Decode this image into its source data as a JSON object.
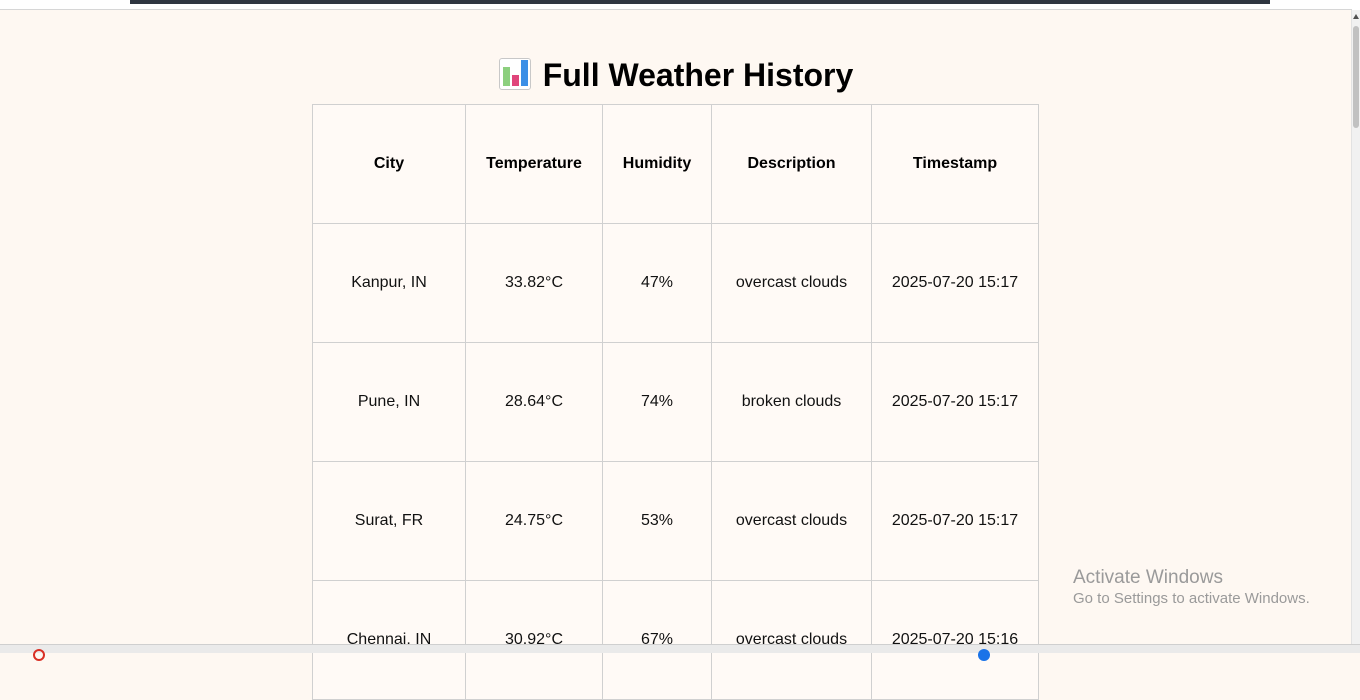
{
  "page": {
    "title": "Full Weather History",
    "title_icon": "bar-chart-icon"
  },
  "table": {
    "headers": {
      "city": "City",
      "temperature": "Temperature",
      "humidity": "Humidity",
      "description": "Description",
      "timestamp": "Timestamp"
    },
    "rows": [
      {
        "city": "Kanpur, IN",
        "temperature": "33.82°C",
        "humidity": "47%",
        "description": "overcast clouds",
        "timestamp": "2025-07-20 15:17"
      },
      {
        "city": "Pune, IN",
        "temperature": "28.64°C",
        "humidity": "74%",
        "description": "broken clouds",
        "timestamp": "2025-07-20 15:17"
      },
      {
        "city": "Surat, FR",
        "temperature": "24.75°C",
        "humidity": "53%",
        "description": "overcast clouds",
        "timestamp": "2025-07-20 15:17"
      },
      {
        "city": "Chennai, IN",
        "temperature": "30.92°C",
        "humidity": "67%",
        "description": "overcast clouds",
        "timestamp": "2025-07-20 15:16"
      }
    ]
  },
  "watermark": {
    "title": "Activate Windows",
    "subtitle": "Go to Settings to activate Windows."
  },
  "colors": {
    "background": "#fef8f2",
    "border": "#d0d0d0"
  }
}
